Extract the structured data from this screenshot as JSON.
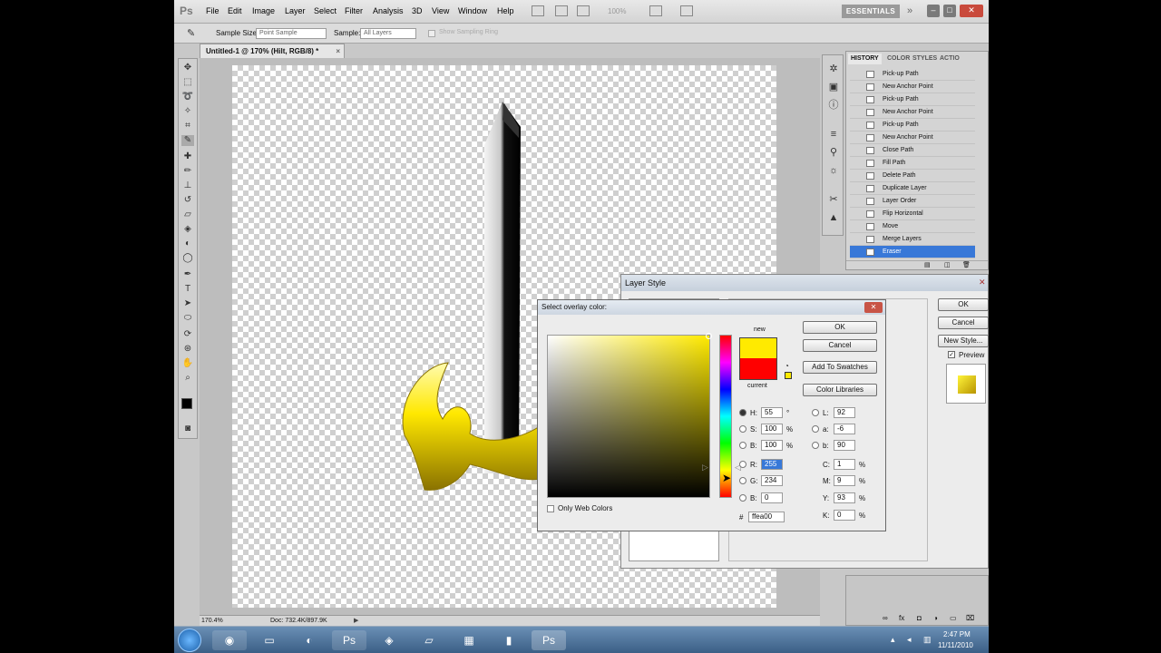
{
  "menubar": {
    "logo": "Ps",
    "items": [
      "File",
      "Edit",
      "Image",
      "Layer",
      "Select",
      "Filter",
      "Analysis",
      "3D",
      "View",
      "Window",
      "Help"
    ],
    "zoom": "100%",
    "workspace": "ESSENTIALS"
  },
  "options": {
    "sample_size_label": "Sample Size:",
    "sample_size_value": "Point Sample",
    "sample_label": "Sample:",
    "sample_value": "All Layers",
    "show_ring": "Show Sampling Ring"
  },
  "document": {
    "tab": "Untitled-1 @ 170% (Hilt, RGB/8) *",
    "zoom_status": "170.4%",
    "doc_status": "Doc: 732.4K/897.9K"
  },
  "history": {
    "tabs": [
      "HISTORY",
      "COLOR",
      "STYLES",
      "ACTIO"
    ],
    "rows": [
      "Pick-up Path",
      "New Anchor Point",
      "Pick-up Path",
      "New Anchor Point",
      "Pick-up Path",
      "New Anchor Point",
      "Close Path",
      "Fill Path",
      "Delete Path",
      "Duplicate Layer",
      "Layer Order",
      "Flip Horizontal",
      "Move",
      "Merge Layers",
      "Eraser"
    ]
  },
  "layer_style": {
    "title": "Layer Style",
    "ok": "OK",
    "cancel": "Cancel",
    "new_style": "New Style...",
    "preview": "Preview"
  },
  "picker": {
    "title": "Select overlay color:",
    "new_label": "new",
    "current_label": "current",
    "ok": "OK",
    "cancel": "Cancel",
    "add_swatches": "Add To Swatches",
    "color_libraries": "Color Libraries",
    "only_web": "Only Web Colors",
    "hue": "55",
    "hue_unit": "°",
    "sat": "100",
    "bri": "100",
    "r": "255",
    "g": "234",
    "b": "0",
    "L": "92",
    "a": "-6",
    "b_lab": "90",
    "C": "1",
    "M": "9",
    "Y": "93",
    "K": "0",
    "hex": "ffea00",
    "new_color": "#ffea00",
    "current_color": "#ff0000"
  },
  "taskbar": {
    "time": "2:47 PM",
    "date": "11/11/2010"
  }
}
